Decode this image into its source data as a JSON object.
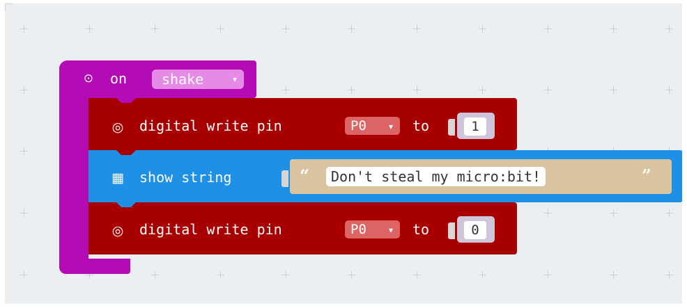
{
  "hat_block": {
    "icon": "radio-icon",
    "on_label": "on",
    "event_value": "shake",
    "color": "#b40cb4"
  },
  "blocks": [
    {
      "icon": "target-icon",
      "label": "digital write pin",
      "pin": "P0",
      "to_label": "to",
      "value": "1",
      "color": "#a80000"
    },
    {
      "icon": "grid-icon",
      "label": "show string",
      "value": "Don't steal my micro:bit!",
      "color": "#1e90e6"
    },
    {
      "icon": "target-icon",
      "label": "digital write pin",
      "pin": "P0",
      "to_label": "to",
      "value": "0",
      "color": "#a80000"
    }
  ],
  "dropdown_arrow": "▾",
  "open_quote": "“",
  "close_quote": "”"
}
